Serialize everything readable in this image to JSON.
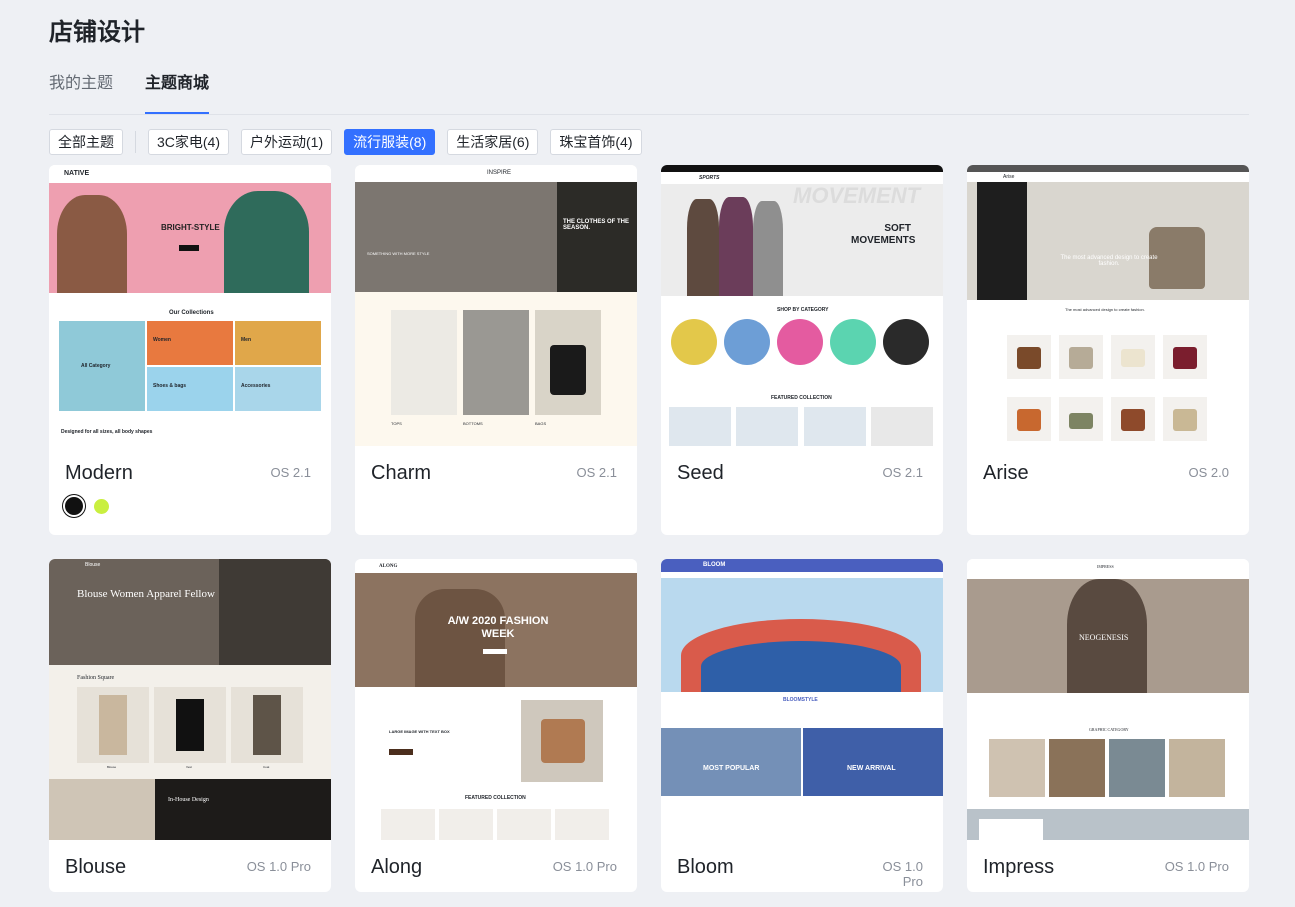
{
  "page": {
    "title": "店铺设计"
  },
  "tabs": [
    {
      "label": "我的主题",
      "active": false
    },
    {
      "label": "主题商城",
      "active": true
    }
  ],
  "filters": [
    {
      "label": "全部主题",
      "active": false
    },
    {
      "label": "3C家电(4)",
      "active": false
    },
    {
      "label": "户外运动(1)",
      "active": false
    },
    {
      "label": "流行服装(8)",
      "active": true
    },
    {
      "label": "生活家居(6)",
      "active": false
    },
    {
      "label": "珠宝首饰(4)",
      "active": false
    }
  ],
  "themes": [
    {
      "name": "Modern",
      "os": "OS 2.1",
      "swatches": [
        {
          "color": "#111111",
          "selected": true
        },
        {
          "color": "#c9ef3f",
          "selected": false
        }
      ],
      "preview": {
        "brand": "NATIVE",
        "hero": "BRIGHT-STYLE",
        "section": "Our Collections",
        "tiles": [
          "All Category",
          "Women",
          "Men",
          "Shoes & bags",
          "Accessories"
        ],
        "footer": "Designed for all sizes, all body shapes"
      }
    },
    {
      "name": "Charm",
      "os": "OS 2.1",
      "preview": {
        "brand": "INSPIRE",
        "hero": "THE CLOTHES OF THE SEASON.",
        "sub": "SOMETHING WITH MORE STYLE",
        "labels": [
          "TOPS",
          "BOTTOMS",
          "BAGS"
        ]
      }
    },
    {
      "name": "Seed",
      "os": "OS 2.1",
      "preview": {
        "brand": "SPORTS",
        "bg_word": "MOVEMENT",
        "hero": "SOFT MOVEMENTS",
        "section": "SHOP BY CATEGORY",
        "section2": "FEATURED COLLECTION"
      }
    },
    {
      "name": "Arise",
      "os": "OS 2.0",
      "preview": {
        "brand": "Arise",
        "hero": "The most advanced design to create fashion.",
        "section": "The most advanced design to create fashion."
      }
    },
    {
      "name": "Blouse",
      "os": "OS 1.0 Pro",
      "preview": {
        "brand": "Blouse",
        "hero": "Blouse Women Apparel Fellow",
        "section": "Fashion Square",
        "labels": [
          "Blouse",
          "Vest",
          "Coat"
        ],
        "section2": "In-House Design"
      }
    },
    {
      "name": "Along",
      "os": "OS 1.0 Pro",
      "preview": {
        "brand": "ALONG",
        "hero": "A/W 2020 FASHION WEEK",
        "block": "LARGE IMAGE WITH TEXT BOX",
        "section": "FEATURED COLLECTION"
      }
    },
    {
      "name": "Bloom",
      "os": "OS 1.0 Pro",
      "preview": {
        "brand": "BLOOM",
        "section": "BLOOMSTYLE",
        "tiles": [
          "MOST POPULAR",
          "NEW ARRIVAL"
        ]
      }
    },
    {
      "name": "Impress",
      "os": "OS 1.0 Pro",
      "preview": {
        "brand": "IMPRESS",
        "hero": "NEOGENESIS",
        "section": "GRAPHIC CATEGORY"
      }
    }
  ]
}
